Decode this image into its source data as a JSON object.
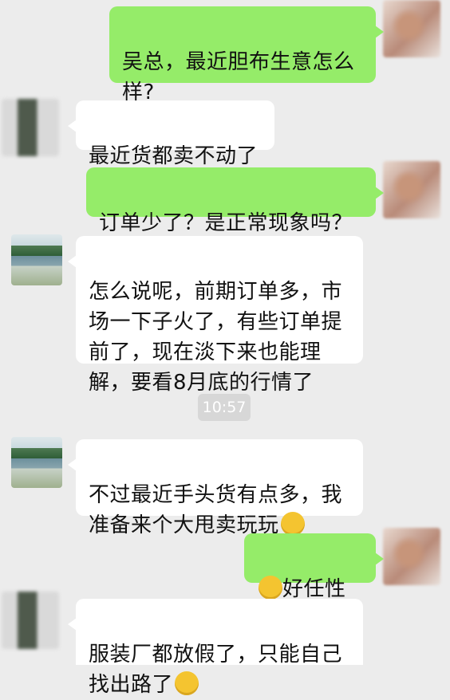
{
  "messages": [
    {
      "id": "m1",
      "side": "me",
      "text": "吴总，最近胆布生意怎么\n样?"
    },
    {
      "id": "m2",
      "side": "them",
      "text": "最近货都卖不动了"
    },
    {
      "id": "m3",
      "side": "me",
      "text": "订单少了？是正常现象吗？"
    },
    {
      "id": "m4",
      "side": "them",
      "text": "怎么说呢，前期订单多，市\n场一下子火了，有些订单提\n前了，现在淡下来也能理\n解，要看8月底的行情了"
    },
    {
      "id": "m5",
      "side": "them",
      "text": "不过最近手头货有点多，我\n准备来个大甩卖玩玩"
    },
    {
      "id": "m6",
      "side": "me",
      "text": "好任性~"
    },
    {
      "id": "m7",
      "side": "them",
      "text": "服装厂都放假了，只能自己\n找出路了"
    }
  ],
  "timestamp": "10:57",
  "emoji_names": {
    "m5": "laugh-tears-emoji-icon",
    "m6": "laugh-tears-emoji-icon",
    "m7": "laugh-tears-emoji-icon"
  },
  "colors": {
    "background": "#ececec",
    "my_bubble": "#95ec69",
    "their_bubble": "#ffffff",
    "time_badge": "#d7d7d7"
  }
}
